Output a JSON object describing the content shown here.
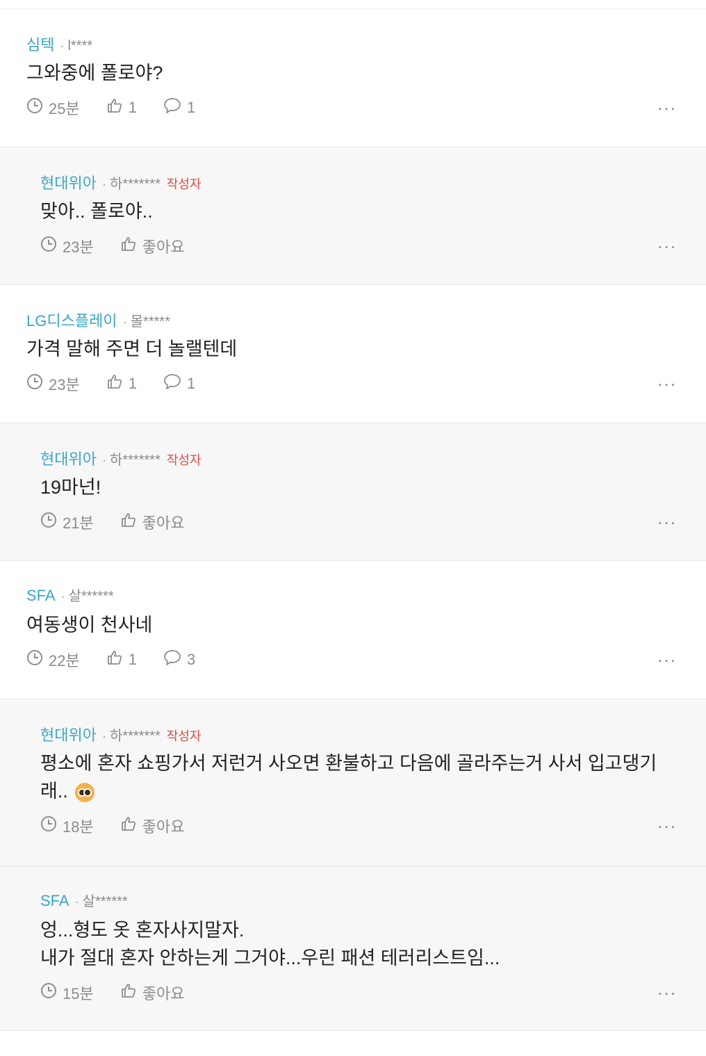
{
  "comments": [
    {
      "company": "심텍",
      "nick": "l****",
      "author": "",
      "text": "그와중에 폴로야?",
      "time": "25분",
      "likes": "1",
      "replies": "1",
      "reply": false
    },
    {
      "company": "현대위아",
      "nick": "하*******",
      "author": "작성자",
      "text": "맞아.. 폴로야..",
      "time": "23분",
      "likes": "좋아요",
      "replies": "",
      "reply": true
    },
    {
      "company": "LG디스플레이",
      "nick": "몰*****",
      "author": "",
      "text": "가격 말해 주면 더 놀랠텐데",
      "time": "23분",
      "likes": "1",
      "replies": "1",
      "reply": false
    },
    {
      "company": "현대위아",
      "nick": "하*******",
      "author": "작성자",
      "text": "19마넌!",
      "time": "21분",
      "likes": "좋아요",
      "replies": "",
      "reply": true
    },
    {
      "company": "SFA",
      "nick": "살******",
      "author": "",
      "text": "여동생이 천사네",
      "time": "22분",
      "likes": "1",
      "replies": "3",
      "reply": false
    },
    {
      "company": "현대위아",
      "nick": "하*******",
      "author": "작성자",
      "text": "평소에 혼자 쇼핑가서 저런거 사오면 환불하고 다음에 골라주는거 사서 입고댕기\n래..",
      "time": "18분",
      "likes": "좋아요",
      "replies": "",
      "reply": true,
      "emoji": "pleading-face"
    },
    {
      "company": "SFA",
      "nick": "살******",
      "author": "",
      "text": "엉...형도 옷 혼자사지말자.\n내가 절대 혼자 안하는게 그거야...우린 패션 테러리스트임...",
      "time": "15분",
      "likes": "좋아요",
      "replies": "",
      "reply": true
    }
  ],
  "more_label": "...",
  "colors": {
    "company": "#3aa6c6",
    "author": "#e24a3b",
    "meta": "#8c8c8c",
    "reply_bg": "#f7f7f8"
  },
  "icons": {
    "time": "clock-icon",
    "like": "thumbs-up-icon",
    "reply": "speech-bubble-icon",
    "more": "more-dots-icon"
  }
}
